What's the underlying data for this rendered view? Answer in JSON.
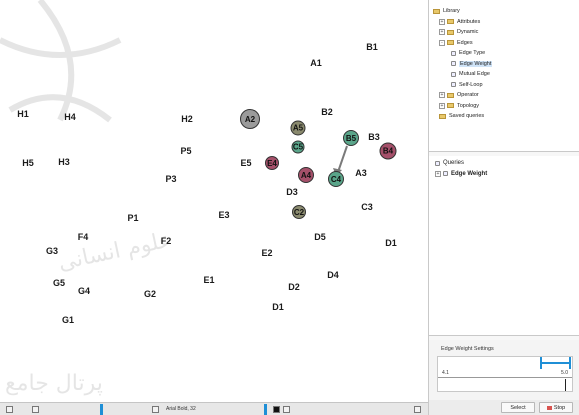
{
  "graph": {
    "labels": [
      {
        "id": "A1",
        "text": "A1"
      },
      {
        "id": "B1",
        "text": "B1"
      },
      {
        "id": "H1",
        "text": "H1"
      },
      {
        "id": "H4",
        "text": "H4"
      },
      {
        "id": "H2",
        "text": "H2"
      },
      {
        "id": "B2",
        "text": "B2"
      },
      {
        "id": "B3",
        "text": "B3"
      },
      {
        "id": "H5",
        "text": "H5"
      },
      {
        "id": "H3",
        "text": "H3"
      },
      {
        "id": "P5",
        "text": "P5"
      },
      {
        "id": "P3",
        "text": "P3"
      },
      {
        "id": "E5",
        "text": "E5"
      },
      {
        "id": "A3",
        "text": "A3"
      },
      {
        "id": "D3",
        "text": "D3"
      },
      {
        "id": "C3",
        "text": "C3"
      },
      {
        "id": "E3",
        "text": "E3"
      },
      {
        "id": "P1",
        "text": "P1"
      },
      {
        "id": "F4",
        "text": "F4"
      },
      {
        "id": "F2",
        "text": "F2"
      },
      {
        "id": "D5",
        "text": "D5"
      },
      {
        "id": "D1",
        "text": "D1"
      },
      {
        "id": "G3",
        "text": "G3"
      },
      {
        "id": "E2",
        "text": "E2"
      },
      {
        "id": "D4",
        "text": "D4"
      },
      {
        "id": "G5",
        "text": "G5"
      },
      {
        "id": "G4",
        "text": "G4"
      },
      {
        "id": "E1",
        "text": "E1"
      },
      {
        "id": "G2",
        "text": "G2"
      },
      {
        "id": "D2",
        "text": "D2"
      },
      {
        "id": "G1",
        "text": "G1"
      },
      {
        "id": "D1b",
        "text": "D1"
      }
    ],
    "circles": [
      {
        "id": "A2",
        "text": "A2",
        "color": "#9b9b9b"
      },
      {
        "id": "A5",
        "text": "A5",
        "color": "#8a8a6e"
      },
      {
        "id": "C5",
        "text": "C5",
        "color": "#5aa58a"
      },
      {
        "id": "B5",
        "text": "B5",
        "color": "#5aa58a"
      },
      {
        "id": "B4",
        "text": "B4",
        "color": "#a5506a"
      },
      {
        "id": "E4",
        "text": "E4",
        "color": "#a5506a"
      },
      {
        "id": "A4",
        "text": "A4",
        "color": "#a5506a"
      },
      {
        "id": "C4",
        "text": "C4",
        "color": "#5aa58a"
      },
      {
        "id": "C2",
        "text": "C2",
        "color": "#8a8a6e"
      }
    ]
  },
  "library": {
    "items": [
      {
        "label": "Library",
        "kind": "folder",
        "expander": ""
      },
      {
        "label": "Attributes",
        "kind": "folder",
        "expander": "+"
      },
      {
        "label": "Dynamic",
        "kind": "folder",
        "expander": "+"
      },
      {
        "label": "Edges",
        "kind": "folder",
        "expander": "-"
      },
      {
        "label": "Edge Type",
        "kind": "leaf",
        "expander": ""
      },
      {
        "label": "Edge Weight",
        "kind": "leaf",
        "expander": ""
      },
      {
        "label": "Mutual Edge",
        "kind": "leaf",
        "expander": ""
      },
      {
        "label": "Self-Loop",
        "kind": "leaf",
        "expander": ""
      },
      {
        "label": "Operator",
        "kind": "folder",
        "expander": "+"
      },
      {
        "label": "Topology",
        "kind": "folder",
        "expander": "+"
      },
      {
        "label": "Saved queries",
        "kind": "folder",
        "expander": ""
      }
    ],
    "selected_index": 5
  },
  "queries": {
    "title": "Queries",
    "item": "Edge Weight"
  },
  "settings": {
    "title": "Edge Weight Settings",
    "min": "4.1",
    "max": "5.0",
    "range_low": 0.78,
    "range_high": 1.0
  },
  "buttons": {
    "select": "Select",
    "stop": "Stop"
  },
  "toolbar": {
    "font_label": "Arial Bold, 32",
    "accent": "#1f8fd6"
  }
}
